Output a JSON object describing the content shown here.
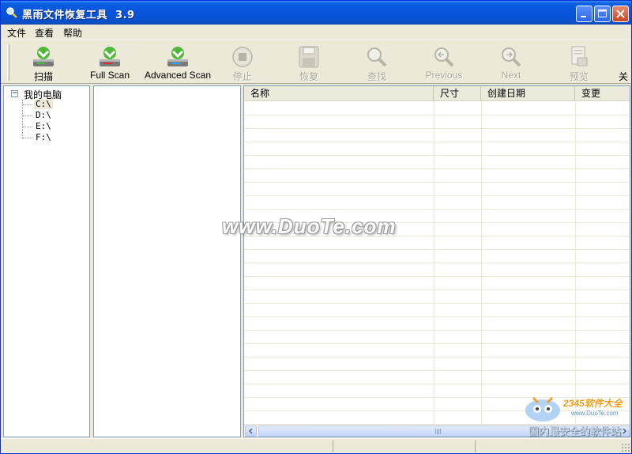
{
  "window": {
    "title": "黑雨文件恢复工具  3.9"
  },
  "menu": [
    "文件",
    "查看",
    "帮助"
  ],
  "toolbar": {
    "scan": "扫描",
    "full_scan": "Full Scan",
    "advanced_scan": "Advanced Scan",
    "stop": "停止",
    "recover": "恢复",
    "find": "查找",
    "previous": "Previous",
    "next": "Next",
    "preview": "预览",
    "close_partial": "关"
  },
  "tree": {
    "root": "我的电脑",
    "root_toggle": "−",
    "drives": [
      "C:\\",
      "D:\\",
      "E:\\",
      "F:\\"
    ],
    "selected": "C:\\"
  },
  "file_list": {
    "columns": [
      "名称",
      "尺寸",
      "创建日期",
      "变更"
    ],
    "rows": []
  },
  "watermarks": {
    "center": "www.DuoTe.com",
    "logo_brand": "2345软件大全",
    "logo_url": "www.DuoTe.com",
    "logo_slogan": "国内最安全的软件站"
  },
  "colors": {
    "titlebar": "#0855dd",
    "window_bg": "#ece9d8",
    "pane_border": "#7f9db9",
    "scan_icon_green": "#4fb83a",
    "full_scan_red": "#d83434",
    "advanced_scan_blue": "#3a9ee8"
  },
  "icons": {
    "title": "magnifier-icon",
    "scan": "drive-scan-icon",
    "full_scan": "drive-full-scan-icon",
    "advanced_scan": "drive-advanced-scan-icon",
    "stop": "stop-icon",
    "recover": "floppy-save-icon",
    "find": "magnifier-icon",
    "previous": "previous-find-icon",
    "next": "next-find-icon",
    "preview": "preview-icon"
  }
}
